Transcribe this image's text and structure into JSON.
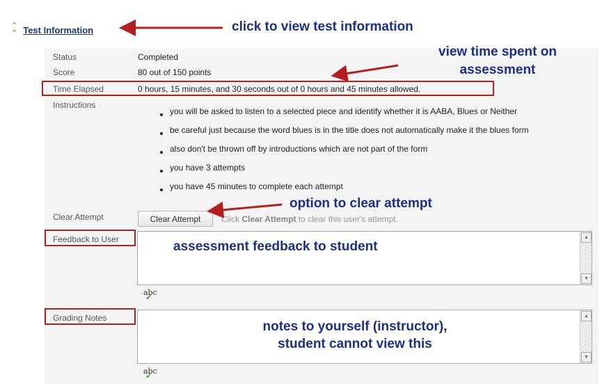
{
  "section": {
    "title": "Test Information"
  },
  "fields": {
    "status_label": "Status",
    "status_value": "Completed",
    "score_label": "Score",
    "score_value": "80 out of 150 points",
    "time_label": "Time Elapsed",
    "time_value": "0 hours, 15 minutes, and 30 seconds out of 0 hours and 45 minutes allowed.",
    "instructions_label": "Instructions",
    "instructions": [
      "you will be asked to listen to a selected piece and identify whether it is AABA, Blues or Neither",
      "be careful just because the word blues is in the title does not automatically make it the blues form",
      "also don't be thrown off by introductions which are not part of the form",
      "you have 3 attempts",
      "you have 45 minutes to complete each attempt"
    ],
    "clear_label": "Clear Attempt",
    "clear_button": "Clear Attempt",
    "clear_help_prefix": "Click ",
    "clear_help_bold": "Clear Attempt",
    "clear_help_suffix": " to clear this user's attempt.",
    "feedback_label": "Feedback to User",
    "grading_label": "Grading Notes",
    "spellcheck": "abc"
  },
  "annotations": {
    "test_info": "click to view test information",
    "time_line1": "view time spent on",
    "time_line2": "assessment",
    "clear": "option to clear attempt",
    "feedback": "assessment feedback to student",
    "notes_line1": "notes to yourself (instructor),",
    "notes_line2": "student cannot view this"
  },
  "colors": {
    "annotation": "#1b2f8a",
    "highlight": "#b31f1f",
    "link": "#1d3a6d"
  }
}
